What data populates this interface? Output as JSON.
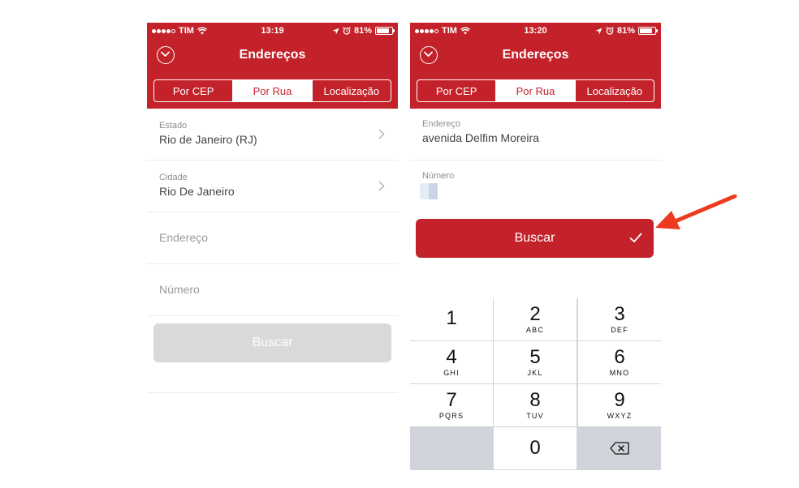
{
  "left_screen": {
    "status": {
      "carrier": "TIM",
      "time": "13:19",
      "battery": "81%"
    },
    "header_title": "Endereços",
    "tabs": [
      {
        "label": "Por CEP",
        "active": false
      },
      {
        "label": "Por Rua",
        "active": true
      },
      {
        "label": "Localização",
        "active": false
      }
    ],
    "fields": {
      "estado": {
        "label": "Estado",
        "value": "Rio de Janeiro (RJ)"
      },
      "cidade": {
        "label": "Cidade",
        "value": "Rio De Janeiro"
      },
      "endereco": {
        "placeholder": "Endereço"
      },
      "numero": {
        "placeholder": "Número"
      }
    },
    "search_button": "Buscar"
  },
  "right_screen": {
    "status": {
      "carrier": "TIM",
      "time": "13:20",
      "battery": "81%"
    },
    "header_title": "Endereços",
    "tabs": [
      {
        "label": "Por CEP",
        "active": false
      },
      {
        "label": "Por Rua",
        "active": true
      },
      {
        "label": "Localização",
        "active": false
      }
    ],
    "fields": {
      "endereco": {
        "label": "Endereço",
        "value": "avenida Delfim Moreira"
      },
      "numero": {
        "label": "Número",
        "value": ""
      }
    },
    "search_button": "Buscar",
    "keypad": {
      "k1": {
        "num": "1",
        "letters": ""
      },
      "k2": {
        "num": "2",
        "letters": "ABC"
      },
      "k3": {
        "num": "3",
        "letters": "DEF"
      },
      "k4": {
        "num": "4",
        "letters": "GHI"
      },
      "k5": {
        "num": "5",
        "letters": "JKL"
      },
      "k6": {
        "num": "6",
        "letters": "MNO"
      },
      "k7": {
        "num": "7",
        "letters": "PQRS"
      },
      "k8": {
        "num": "8",
        "letters": "TUV"
      },
      "k9": {
        "num": "9",
        "letters": "WXYZ"
      },
      "k0": {
        "num": "0",
        "letters": ""
      }
    }
  },
  "colors": {
    "brand_red": "#c4222a",
    "annotation_arrow": "#ee3a1f",
    "disabled_button": "#d9d9d9"
  },
  "icons": [
    "chevron-down-circle-icon",
    "chevron-right-icon",
    "checkmark-icon",
    "backspace-icon",
    "wifi-icon",
    "location-arrow-icon",
    "alarm-icon",
    "battery-icon"
  ]
}
